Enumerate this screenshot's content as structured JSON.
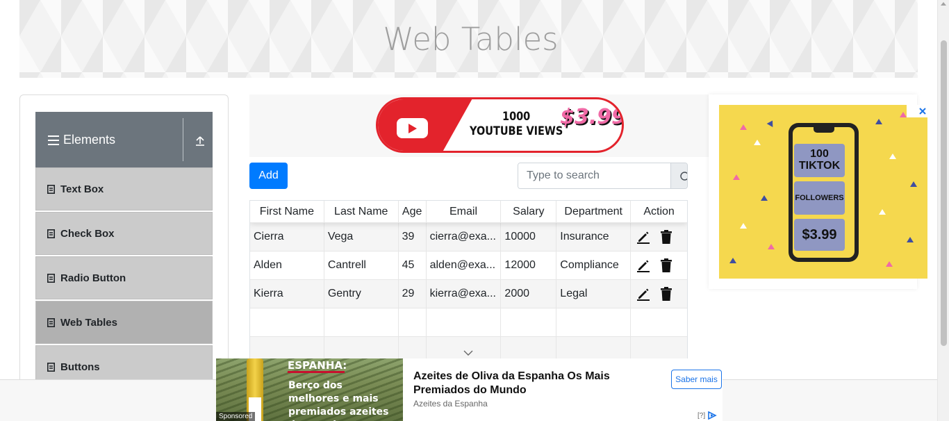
{
  "page": {
    "title": "Web Tables"
  },
  "sidebar": {
    "group_title": "Elements",
    "items": [
      {
        "label": "Text Box"
      },
      {
        "label": "Check Box"
      },
      {
        "label": "Radio Button"
      },
      {
        "label": "Web Tables",
        "active": true
      },
      {
        "label": "Buttons"
      }
    ]
  },
  "top_ad": {
    "line1": "1000",
    "line2": "YOUTUBE VIEWS",
    "price": "$3.99"
  },
  "toolbar": {
    "add_label": "Add",
    "search_placeholder": "Type to search"
  },
  "table": {
    "headers": [
      "First Name",
      "Last Name",
      "Age",
      "Email",
      "Salary",
      "Department",
      "Action"
    ],
    "rows": [
      {
        "first": "Cierra",
        "last": "Vega",
        "age": "39",
        "email": "cierra@exa...",
        "salary": "10000",
        "department": "Insurance"
      },
      {
        "first": "Alden",
        "last": "Cantrell",
        "age": "45",
        "email": "alden@exa...",
        "salary": "12000",
        "department": "Compliance"
      },
      {
        "first": "Kierra",
        "last": "Gentry",
        "age": "29",
        "email": "kierra@exa...",
        "salary": "2000",
        "department": "Legal"
      }
    ]
  },
  "right_ad": {
    "box1": "100 TIKTOK",
    "box2": "FOLLOWERS",
    "box3": "$3.99"
  },
  "bottom_ad": {
    "image_heading": "ESPANHA:",
    "image_text": "Berço dos melhores e mais premiados azeites do mundo",
    "sponsored": "Sponsored",
    "title": "Azeites de Oliva da Espanha Os Mais Premiados do Mundo",
    "source": "Azeites da Espanha",
    "cta": "Saber mais",
    "ad_info": "[?]"
  },
  "colors": {
    "primary": "#007bff",
    "sidebar_header": "#6c757d",
    "sidebar_item": "#cbcbcb",
    "sidebar_item_active": "#b1b1b1"
  }
}
